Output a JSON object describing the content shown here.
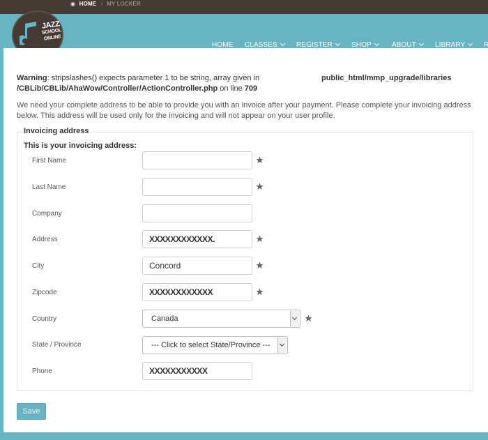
{
  "header": {
    "breadcrumb": {
      "home": "HOME",
      "current": "MY LOCKER"
    },
    "logo": {
      "line1": "JAZZ",
      "line2": "SCHOOL",
      "line3": "ONLINE"
    },
    "nav": [
      {
        "label": "HOME",
        "dropdown": false
      },
      {
        "label": "CLASSES",
        "dropdown": true
      },
      {
        "label": "REGISTER",
        "dropdown": true
      },
      {
        "label": "SHOP",
        "dropdown": true
      },
      {
        "label": "ABOUT",
        "dropdown": true
      },
      {
        "label": "LIBRARY",
        "dropdown": true
      },
      {
        "label": "R",
        "dropdown": false
      }
    ]
  },
  "warning": {
    "label": "Warning",
    "text": ": stripslashes() expects parameter 1 to be string, array given in",
    "path_right": "public_html/mmp_upgrade/libraries",
    "file": "/CBLib/CBLib/AhaWow/Controller/ActionController.php",
    "on_line": " on line ",
    "line": "709"
  },
  "intro": "We need your complete address to be able to provide you with an invoice after your payment. Please complete your invoicing address below. This address will be used only for the invoicing and will not appear on your user profile.",
  "form": {
    "legend": "Invoicing address",
    "subheading": "This is your invoicing address:",
    "fields": {
      "first_name": {
        "label": "First Name",
        "value": "",
        "required": true
      },
      "last_name": {
        "label": "Last Name",
        "value": "",
        "required": true
      },
      "company": {
        "label": "Company",
        "value": "",
        "required": false
      },
      "address": {
        "label": "Address",
        "value": "XXXXXXXXXXXX.",
        "required": true
      },
      "city": {
        "label": "City",
        "value": "Concord",
        "required": true
      },
      "zipcode": {
        "label": "Zipcode",
        "value": "XXXXXXXXXXXX",
        "required": true
      },
      "country": {
        "label": "Country",
        "value": "Canada",
        "required": true
      },
      "state": {
        "label": "State / Province",
        "value": "--- Click to select State/Province ---",
        "required": false
      },
      "phone": {
        "label": "Phone",
        "value": "XXXXXXXXXXX",
        "required": false
      }
    },
    "save_label": "Save"
  },
  "colors": {
    "accent": "#67b4c3",
    "header_dark": "#453b34",
    "star": "#666666"
  },
  "icons": {
    "required": "star-icon",
    "dropdown": "chevron-down-icon",
    "location": "pin-icon",
    "logo": "music-note-icon"
  }
}
